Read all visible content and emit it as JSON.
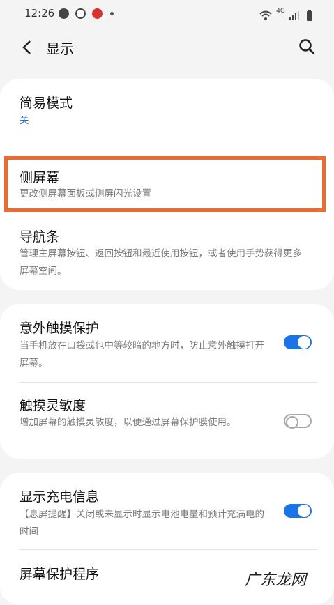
{
  "status_bar": {
    "time": "12:26",
    "network": "4G",
    "icons": [
      "chat-icon",
      "music-icon",
      "headphones-icon",
      "dot-icon",
      "wifi-icon",
      "signal-icon",
      "battery-icon"
    ]
  },
  "app_bar": {
    "title": "显示",
    "back_icon": "chevron-left-icon",
    "search_icon": "search-icon"
  },
  "groups": [
    {
      "items": [
        {
          "title": "简易模式",
          "subtitle": "关"
        },
        {
          "title": "侧屏幕",
          "subtitle": "更改侧屏幕面板或侧屏闪光设置"
        },
        {
          "title": "导航条",
          "subtitle": "管理主屏幕按钮、返回按钮和最近使用按钮，或者使用手势获得更多屏幕空间。"
        }
      ]
    },
    {
      "items": [
        {
          "title": "意外触摸保护",
          "subtitle": "当手机放在口袋或包中等较暗的地方时，防止意外触摸打开屏幕。",
          "toggle": "on"
        },
        {
          "title": "触摸灵敏度",
          "subtitle": "增加屏幕的触摸灵敏度，以便通过屏幕保护膜使用。",
          "toggle": "off"
        }
      ]
    },
    {
      "items": [
        {
          "title": "显示充电信息",
          "subtitle": "【息屏提醒】关闭或未显示时显示电池电量和预计充满电的时间",
          "toggle": "on"
        },
        {
          "title": "屏幕保护程序"
        }
      ]
    }
  ],
  "colors": {
    "accent": "#1a73e8",
    "highlight_border": "#ef6a2f",
    "background": "#f4f4f4"
  },
  "watermark": "广东龙网"
}
